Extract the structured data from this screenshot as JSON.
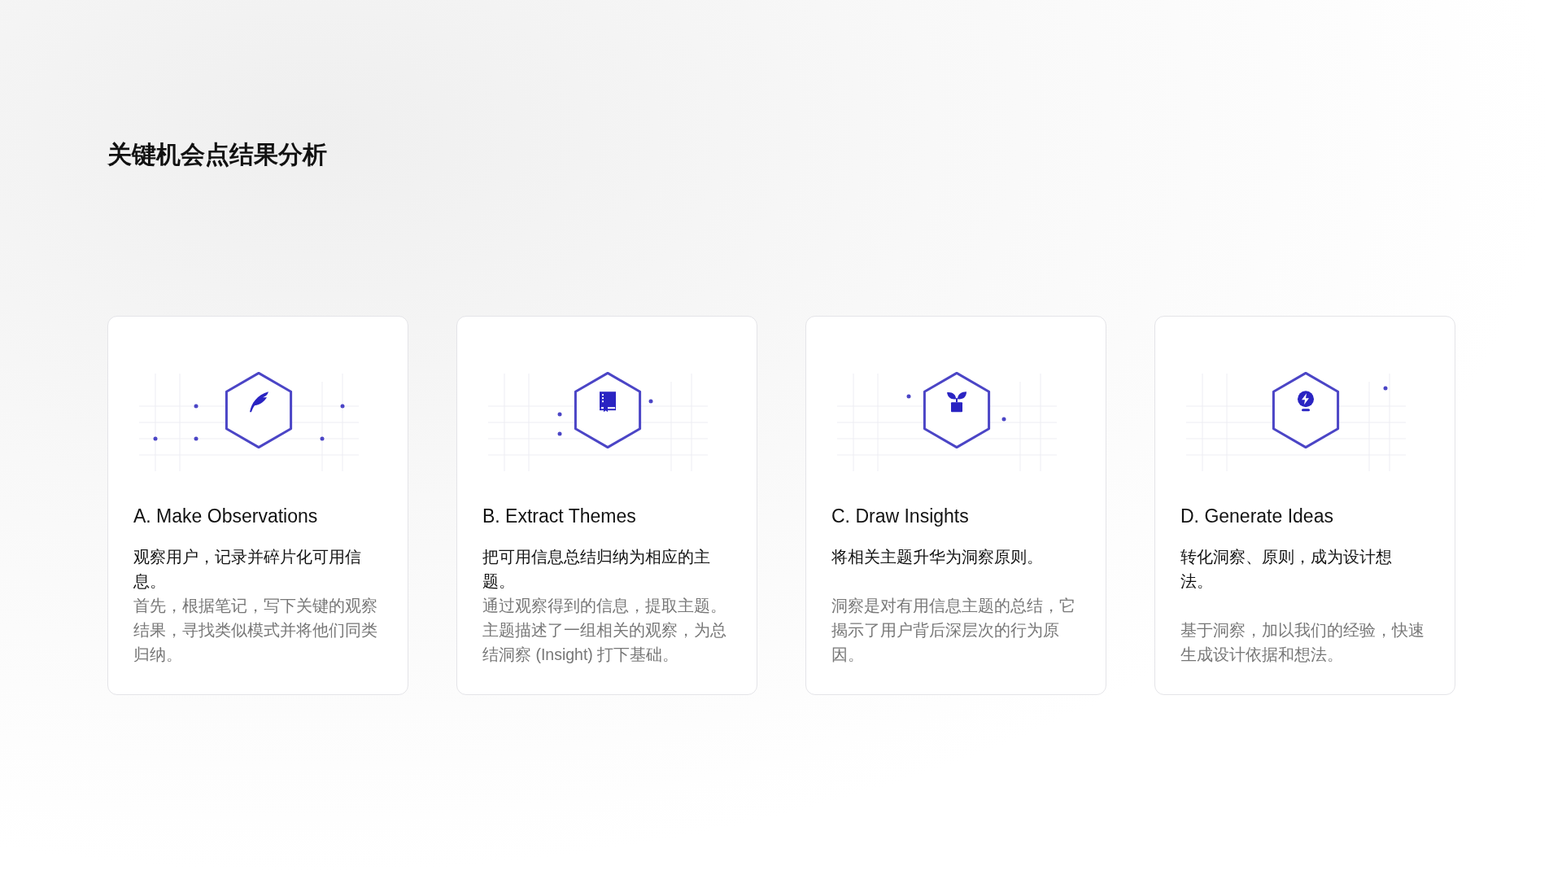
{
  "title": "关键机会点结果分析",
  "cards": [
    {
      "heading": "A. Make Observations",
      "summary": "观察用户，记录并碎片化可用信息。",
      "description": "首先，根据笔记，写下关键的观察结果，寻找类似模式并将他们同类归纳。"
    },
    {
      "heading": "B. Extract Themes",
      "summary": "把可用信息总结归纳为相应的主题。",
      "description": "通过观察得到的信息，提取主题。主题描述了一组相关的观察，为总结洞察 (Insight) 打下基础。"
    },
    {
      "heading": "C. Draw Insights",
      "summary": "将相关主题升华为洞察原则。",
      "description": "洞察是对有用信息主题的总结，它揭示了用户背后深层次的行为原因。"
    },
    {
      "heading": "D. Generate Ideas",
      "summary": "转化洞察、原则，成为设计想法。",
      "description": "基于洞察，加以我们的经验，快速生成设计依据和想法。"
    }
  ]
}
